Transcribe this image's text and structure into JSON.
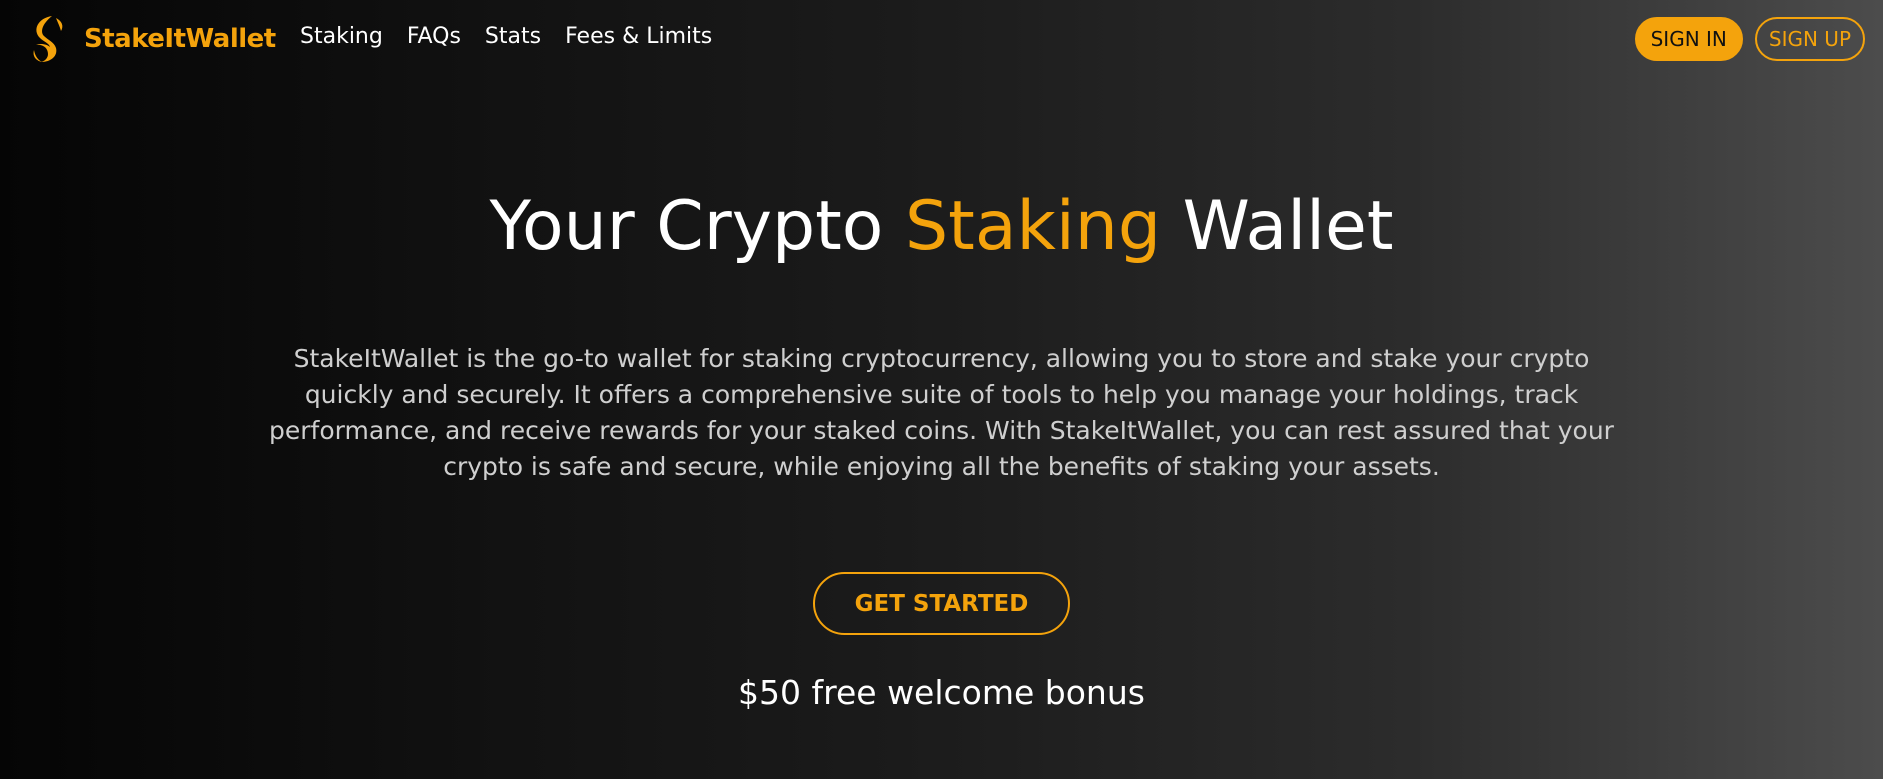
{
  "brand": {
    "name": "StakeItWallet",
    "logo_icon": "swirl-s-logo-icon",
    "color": "#f4a30c"
  },
  "nav": {
    "items": [
      {
        "label": "Staking"
      },
      {
        "label": "FAQs"
      },
      {
        "label": "Stats"
      },
      {
        "label": "Fees & Limits"
      }
    ]
  },
  "auth": {
    "sign_in_label": "SIGN IN",
    "sign_up_label": "SIGN UP"
  },
  "hero": {
    "title_prefix": "Your Crypto ",
    "title_accent": "Staking",
    "title_suffix": " Wallet",
    "description": "StakeItWallet is the go-to wallet for staking cryptocurrency, allowing you to store and stake your crypto quickly and securely. It offers a comprehensive suite of tools to help you manage your holdings, track performance, and receive rewards for your staked coins. With StakeItWallet, you can rest assured that your crypto is safe and secure, while enjoying all the benefits of staking your assets.",
    "cta_label": "GET STARTED",
    "bonus_text": "$50 free welcome bonus"
  },
  "colors": {
    "accent": "#f4a30c",
    "background_start": "#050505",
    "background_end": "#4c4c4c",
    "text": "#ffffff",
    "muted_text": "#cfcfcf"
  }
}
